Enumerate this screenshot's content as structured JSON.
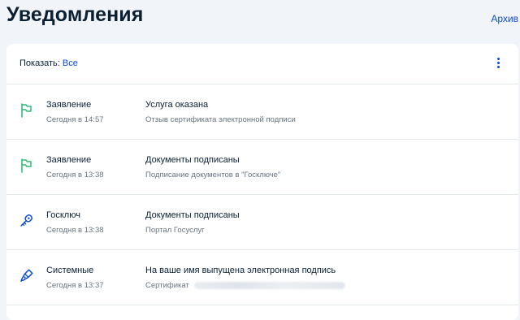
{
  "header": {
    "title": "Уведомления",
    "archive_label": "Архив"
  },
  "filter": {
    "label": "Показать:",
    "value": "Все"
  },
  "menu": {
    "icon": "kebab-menu-icon"
  },
  "notifications": [
    {
      "icon": "flag-icon",
      "icon_color": "#2fbc7a",
      "source": "Заявление",
      "time": "Сегодня в 14:57",
      "title": "Услуга оказана",
      "description": "Отзыв сертификата электронной подписи"
    },
    {
      "icon": "flag-icon",
      "icon_color": "#2fbc7a",
      "source": "Заявление",
      "time": "Сегодня в 13:38",
      "title": "Документы подписаны",
      "description": "Подписание документов в \"Госключе\""
    },
    {
      "icon": "key-icon",
      "icon_color": "#0d4cd3",
      "source": "Госключ",
      "time": "Сегодня в 13:38",
      "title": "Документы подписаны",
      "description": "Портал Госуслуг"
    },
    {
      "icon": "pen-icon",
      "icon_color": "#0d4cd3",
      "source": "Системные",
      "time": "Сегодня в 13:37",
      "title": "На ваше имя выпущена электронная подпись",
      "description": "Сертификат"
    }
  ],
  "colors": {
    "accent": "#0d4cd3",
    "success": "#2fbc7a",
    "text": "#0b1f33",
    "muted": "#66727f",
    "background": "#f1f4f9"
  }
}
